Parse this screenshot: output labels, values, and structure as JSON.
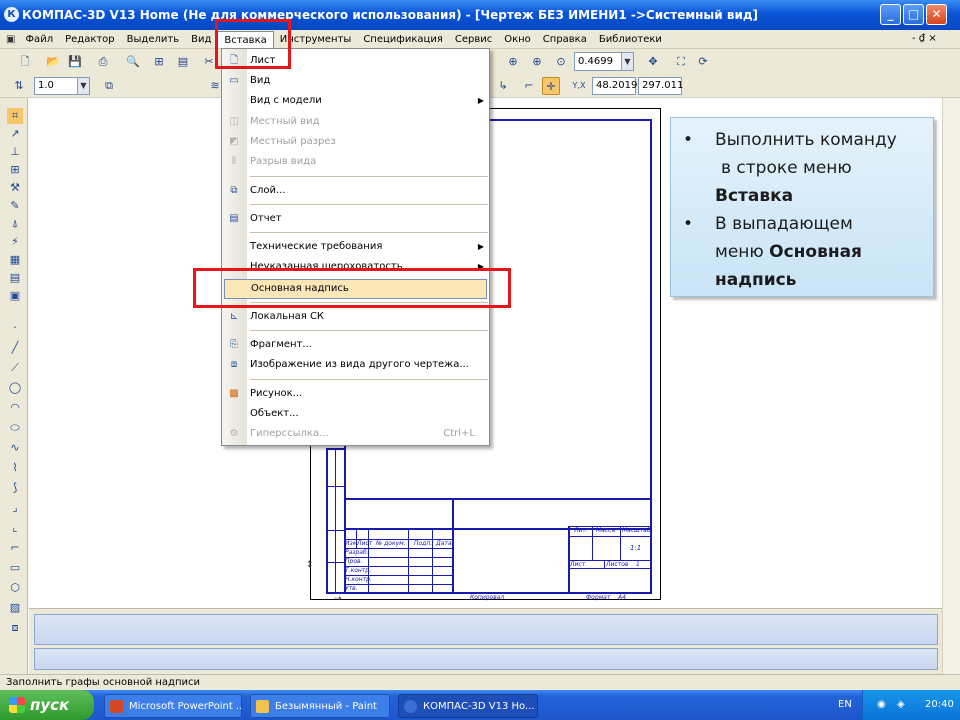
{
  "window": {
    "title": "КОМПАС-3D V13 Home (Не для коммерческого использования) - [Чертеж БЕЗ ИМЕНИ1 ->Системный вид]",
    "minimize": "_",
    "maximize": "□",
    "close": "✕"
  },
  "menubar": {
    "items": [
      "Файл",
      "Редактор",
      "Выделить",
      "Вид",
      "Вставка",
      "Инструменты",
      "Спецификация",
      "Сервис",
      "Окно",
      "Справка",
      "Библиотеки"
    ],
    "mdi_controls": "- ₫ ×"
  },
  "toolbar1": {
    "zoom_value": "0.4699"
  },
  "toolbar2": {
    "scale_value": "1.0",
    "coord_x": "48.2019",
    "coord_y": "297.011"
  },
  "insert_menu": {
    "items": [
      {
        "label": "Лист",
        "icon": "sheet-icon",
        "disabled": false,
        "submenu": false
      },
      {
        "label": "Вид",
        "icon": "view-icon",
        "disabled": false,
        "submenu": false
      },
      {
        "label": "Вид с модели",
        "icon": "",
        "disabled": false,
        "submenu": true
      },
      {
        "label": "Местный вид",
        "icon": "local-view-icon",
        "disabled": true,
        "submenu": false
      },
      {
        "label": "Местный разрез",
        "icon": "local-section-icon",
        "disabled": true,
        "submenu": false
      },
      {
        "label": "Разрыв вида",
        "icon": "view-break-icon",
        "disabled": true,
        "submenu": false
      },
      {
        "label": "Слой...",
        "icon": "layer-icon",
        "disabled": false,
        "submenu": false
      },
      {
        "label": "Отчет",
        "icon": "report-icon",
        "disabled": false,
        "submenu": false
      },
      {
        "label": "Технические требования",
        "icon": "",
        "disabled": false,
        "submenu": true
      },
      {
        "label": "Неуказанная шероховатость",
        "icon": "",
        "disabled": false,
        "submenu": true
      },
      {
        "label": "Основная надпись",
        "icon": "",
        "disabled": false,
        "submenu": false,
        "highlighted": true
      },
      {
        "label": "Локальная СК",
        "icon": "local-cs-icon",
        "disabled": false,
        "submenu": false
      },
      {
        "label": "Фрагмент...",
        "icon": "fragment-icon",
        "disabled": false,
        "submenu": false
      },
      {
        "label": "Изображение из вида другого чертежа...",
        "icon": "image-from-view-icon",
        "disabled": false,
        "submenu": false
      },
      {
        "label": "Рисунок...",
        "icon": "picture-icon",
        "disabled": false,
        "submenu": false
      },
      {
        "label": "Объект...",
        "icon": "",
        "disabled": false,
        "submenu": false
      },
      {
        "label": "Гиперссылка...",
        "icon": "hyperlink-icon",
        "disabled": true,
        "submenu": false,
        "shortcut": "Ctrl+L"
      }
    ]
  },
  "callout": {
    "bullet1_line1": "Выполнить команду",
    "bullet1_line2": "в строке меню",
    "bullet1_bold": "Вставка",
    "bullet2_line1": "В выпадающем",
    "bullet2_line2": "меню ",
    "bullet2_bold1": "Основная",
    "bullet2_bold2": "надпись"
  },
  "title_block": {
    "col_headers": [
      "Изм.",
      "Лист",
      "№ докум.",
      "Подп.",
      "Дата"
    ],
    "rows": [
      "Разраб.",
      "Пров.",
      "Т.контр.",
      "Н.контр.",
      "Утв."
    ],
    "lit": "Лит.",
    "mass": "Масса",
    "scale": "Масштаб",
    "scale_value": "1:1",
    "sheet": "Лист",
    "sheets": "Листов",
    "sheets_count": "1",
    "copied": "Копировал",
    "format": "Формат",
    "format_value": "A4"
  },
  "statusbar": {
    "text": "Заполнить графы основной надписи"
  },
  "taskbar": {
    "start": "пуск",
    "tasks": [
      {
        "label": "Microsoft PowerPoint ...",
        "color": "#d24726"
      },
      {
        "label": "Безымянный - Paint",
        "color": "#f2c14e"
      },
      {
        "label": "КОМПАС-3D V13 Ho...",
        "color": "#3b6fd6"
      }
    ],
    "lang": "EN",
    "clock": "20:40"
  }
}
